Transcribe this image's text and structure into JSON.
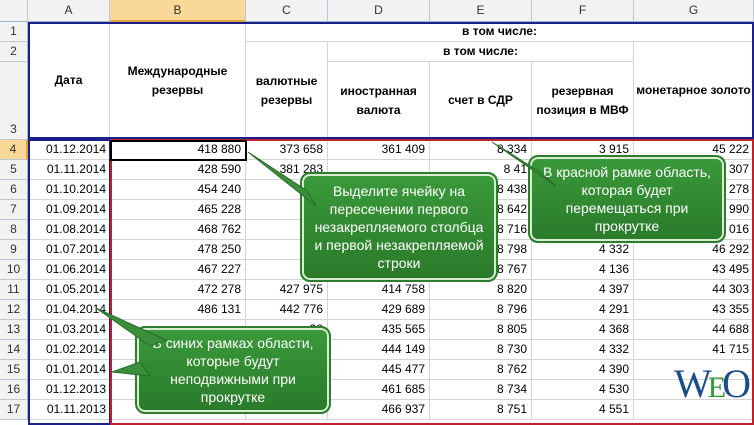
{
  "columns": [
    "A",
    "B",
    "C",
    "D",
    "E",
    "F",
    "G"
  ],
  "row_numbers": [
    "1",
    "2",
    "3",
    "4",
    "5",
    "6",
    "7",
    "8",
    "9",
    "10",
    "11",
    "12",
    "13",
    "14",
    "15",
    "16",
    "17"
  ],
  "headers": {
    "date": "Дата",
    "reserves": "Международные резервы",
    "in_total": "в том числе:",
    "currency_reserves": "валютные резервы",
    "in_total2": "в том числе:",
    "foreign_currency": "иностранная валюта",
    "sdr": "счет в СДР",
    "imf": "резервная позиция в МВФ",
    "gold": "монетарное золото"
  },
  "rows": [
    {
      "date": "01.12.2014",
      "b": "418 880",
      "c": "373 658",
      "d": "361 409",
      "e": "8 334",
      "f": "3 915",
      "g": "45 222"
    },
    {
      "date": "01.11.2014",
      "b": "428 590",
      "c": "381 283",
      "d": "",
      "e": "8 41",
      "f": "",
      "g": "307"
    },
    {
      "date": "01.10.2014",
      "b": "454 240",
      "c": "",
      "d": "",
      "e": "8 438",
      "f": "",
      "g": "278"
    },
    {
      "date": "01.09.2014",
      "b": "465 228",
      "c": "",
      "d": "",
      "e": "8 642",
      "f": "",
      "g": "990"
    },
    {
      "date": "01.08.2014",
      "b": "468 762",
      "c": "",
      "d": "",
      "e": "8 716",
      "f": "",
      "g": "016"
    },
    {
      "date": "01.07.2014",
      "b": "478 250",
      "c": "",
      "d": "",
      "e": "8 798",
      "f": "4 332",
      "g": "46 292"
    },
    {
      "date": "01.06.2014",
      "b": "467 227",
      "c": "",
      "d": "",
      "e": "8 767",
      "f": "4 136",
      "g": "43 495"
    },
    {
      "date": "01.05.2014",
      "b": "472 278",
      "c": "427 975",
      "d": "414 758",
      "e": "8 820",
      "f": "4 397",
      "g": "44 303"
    },
    {
      "date": "01.04.2014",
      "b": "486 131",
      "c": "442 776",
      "d": "429 689",
      "e": "8 796",
      "f": "4 291",
      "g": "43 355"
    },
    {
      "date": "01.03.2014",
      "b": "",
      "c": "38",
      "d": "435 565",
      "e": "8 805",
      "f": "4 368",
      "g": "44 688"
    },
    {
      "date": "01.02.2014",
      "b": "",
      "c": "",
      "d": "444 149",
      "e": "8 730",
      "f": "4 332",
      "g": "41 715"
    },
    {
      "date": "01.01.2014",
      "b": "",
      "c": "",
      "d": "445 477",
      "e": "8 762",
      "f": "4 390",
      "g": ""
    },
    {
      "date": "01.12.2013",
      "b": "",
      "c": "",
      "d": "461 685",
      "e": "8 734",
      "f": "4 530",
      "g": ""
    },
    {
      "date": "01.11.2013",
      "b": "",
      "c": "238",
      "d": "466 937",
      "e": "8 751",
      "f": "4 551",
      "g": ""
    }
  ],
  "callouts": {
    "select_cell": "Выделите ячейку на пересечении первого незакрепляемого столбца и первой незакрепляемой строки",
    "red_frame": "В красной рамке область, которая будет перемещаться при прокрутке",
    "blue_frame": "В синих рамках области, которые будут неподвижными при прокрутке"
  },
  "logo": {
    "w": "W",
    "e": "E",
    "o": "O"
  },
  "colors": {
    "blue_frame": "#1b1f8a",
    "red_frame": "#c0202a",
    "callout_green": "#2e8b2e",
    "selected_header": "#f9d99a"
  }
}
